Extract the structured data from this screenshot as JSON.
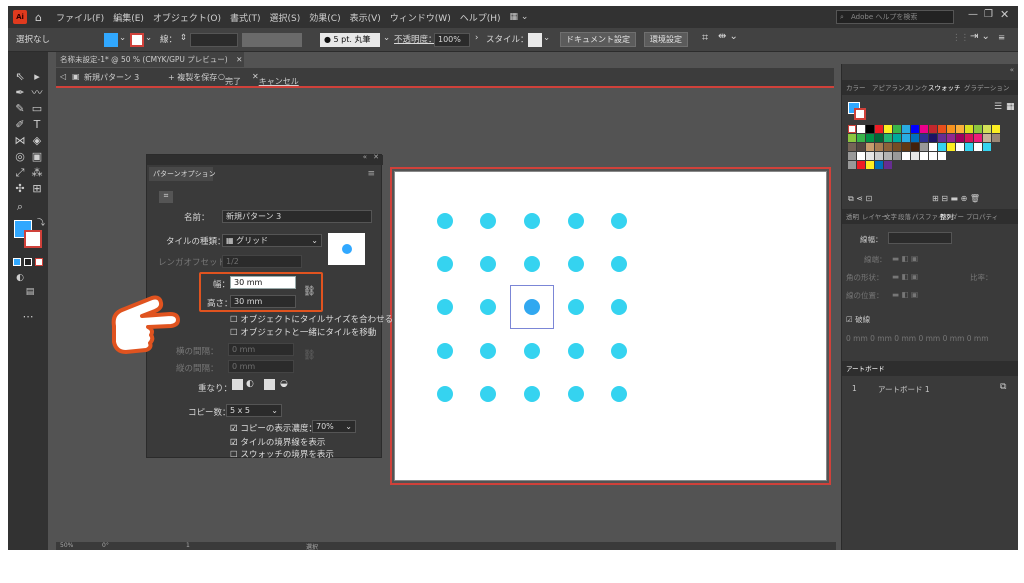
{
  "menubar": {
    "items": [
      "ファイル(F)",
      "編集(E)",
      "オブジェクト(O)",
      "書式(T)",
      "選択(S)",
      "効果(C)",
      "表示(V)",
      "ウィンドウ(W)",
      "ヘルプ(H)"
    ],
    "search_placeholder": "Adobe ヘルプを検索",
    "app_logo": "Ai"
  },
  "controlbar": {
    "selection": "選択なし",
    "stroke_label": "線：",
    "brush": "5 pt. 丸筆",
    "opacity_label": "不透明度：",
    "opacity_value": "100%",
    "style_label": "スタイル：",
    "doc_settings": "ドキュメント設定",
    "preferences": "環境設定"
  },
  "document": {
    "tab_title": "名称未設定-1* @ 50 % (CMYK/GPU プレビュー)",
    "isolation_label": "新規パターン 3",
    "save_copy": "+ 複製を保存",
    "done": "完了",
    "cancel": "キャンセル"
  },
  "pattern_options": {
    "tab": "パターンオプション",
    "name_label": "名前：",
    "name_value": "新規パターン 3",
    "tile_type_label": "タイルの種類：",
    "tile_type_value": "グリッド",
    "brick_offset_label": "レンガオフセット：",
    "brick_offset_value": "1/2",
    "width_label": "幅：",
    "width_value": "30 mm",
    "height_label": "高さ：",
    "height_value": "30 mm",
    "fit_tile": "オブジェクトにタイルサイズを合わせる",
    "move_tile": "オブジェクトと一緒にタイルを移動",
    "h_spacing_label": "横の間隔：",
    "h_spacing_value": "0 mm",
    "v_spacing_label": "縦の間隔：",
    "v_spacing_value": "0 mm",
    "overlap_label": "重なり：",
    "copies_label": "コピー数：",
    "copies_value": "5 x 5",
    "dim_copies": "コピーの表示濃度：",
    "dim_value": "70%",
    "show_tile_edge": "タイルの境界線を表示",
    "show_swatch_bounds": "スウォッチの境界を表示",
    "fit_checked": false,
    "move_checked": false,
    "dim_checked": true,
    "tile_edge_checked": true,
    "swatch_bounds_checked": false
  },
  "right_panel": {
    "tabs1": [
      "カラー",
      "アピアランス",
      "リンク",
      "スウォッチ",
      "グラデーション"
    ],
    "tabs2": [
      "透明",
      "レイヤー",
      "文字",
      "段落",
      "パスファインダー",
      "整列",
      "プロパティ"
    ],
    "stroke_width_label": "線幅：",
    "stroke_label2": "線端：",
    "corner_label": "角の形状：",
    "limit_label": "比率：",
    "align_label": "線の位置：",
    "dash_label": "破線",
    "artboard_tab": "アートボード",
    "artboard_row_num": "1",
    "artboard_row_name": "アートボード 1"
  },
  "statusbar": {
    "zoom": "50%",
    "rotation": "0°",
    "artboard_num": "1",
    "tool": "選択"
  },
  "colors": {
    "dot": "#35d3f0",
    "accent_blue": "#31a8ff",
    "highlight": "#e0531f",
    "isolation_border": "#d0413a"
  }
}
